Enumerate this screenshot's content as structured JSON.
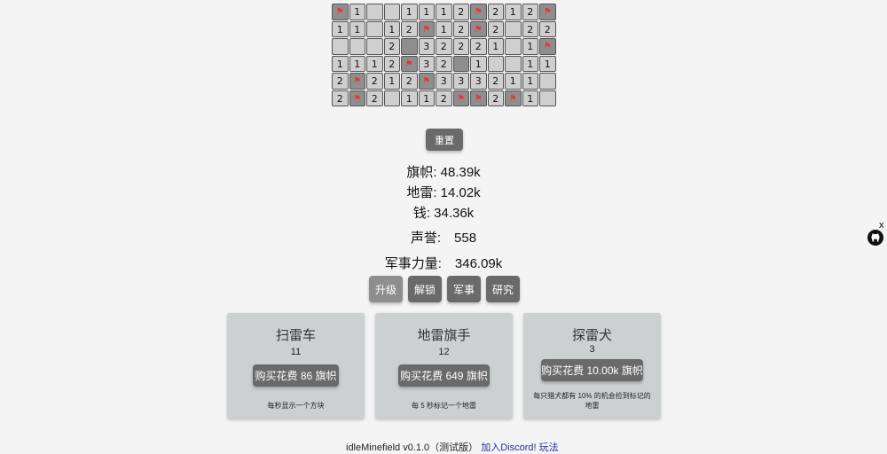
{
  "board": [
    [
      "F",
      "1",
      "",
      "",
      "1",
      "1",
      "1",
      "2",
      "F",
      "2",
      "1",
      "2",
      "F"
    ],
    [
      "1",
      "1",
      "",
      "1",
      "2",
      "F",
      "1",
      "2",
      "F",
      "2",
      "",
      "2",
      "2"
    ],
    [
      "",
      "",
      "",
      "2",
      "#",
      "3",
      "2",
      "2",
      "2",
      "1",
      "",
      "1",
      "F"
    ],
    [
      "1",
      "1",
      "1",
      "2",
      "F",
      "3",
      "2",
      "#",
      "1",
      "",
      "",
      "1",
      "1"
    ],
    [
      "2",
      "F",
      "2",
      "1",
      "2",
      "F",
      "3",
      "3",
      "3",
      "2",
      "1",
      "1",
      ""
    ],
    [
      "2",
      "F",
      "2",
      "",
      "1",
      "1",
      "2",
      "F",
      "F",
      "2",
      "F",
      "1",
      ""
    ]
  ],
  "reset_label": "重置",
  "stats": {
    "flags": "旗帜: 48.39k",
    "mines": "地雷: 14.02k",
    "money": "钱: 34.36k",
    "prestige": "声誉:　558",
    "military_power": "军事力量:　346.09k"
  },
  "tabs": [
    "升级",
    "解锁",
    "军事",
    "研究"
  ],
  "cards": [
    {
      "title": "扫雷车",
      "count": "11",
      "button": "购买花费 86 旗帜",
      "desc": "每秒显示一个方块"
    },
    {
      "title": "地雷旗手",
      "count": "12",
      "button": "购买花费 649 旗帜",
      "desc": "每 5 秒标记一个地雷"
    },
    {
      "title": "探雷犬",
      "count": "3",
      "button": "购买花费 10.00k 旗帜",
      "desc": "每只猎犬都有 10% 的机会捡到标记的地雷"
    }
  ],
  "footer": {
    "text": "idleMinefield v0.1.0（测试版）",
    "discord": "加入Discord!",
    "rules": "玩法"
  },
  "flag_glyph": "⚑",
  "close_glyph": "x",
  "colors": {
    "accent_button": "#6a6a6a",
    "flag": "#e53935",
    "closed_cell": "#8e8e8e",
    "open_cell": "#cfcfcf"
  }
}
